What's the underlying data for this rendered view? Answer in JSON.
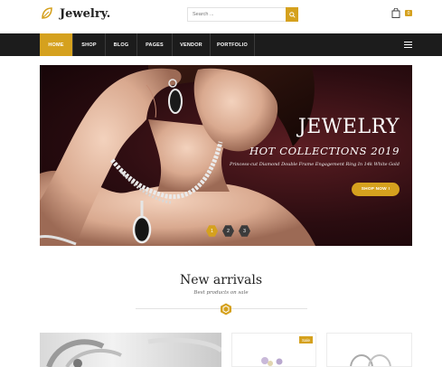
{
  "header": {
    "logo_text": "Jewelry.",
    "search_placeholder": "Search ...",
    "cart_count": "0"
  },
  "nav": {
    "items": [
      {
        "label": "HOME",
        "active": true
      },
      {
        "label": "SHOP"
      },
      {
        "label": "BLOG"
      },
      {
        "label": "PAGES"
      },
      {
        "label": "VENDOR"
      },
      {
        "label": "PORTFOLIO"
      }
    ]
  },
  "hero": {
    "title": "JEWELRY",
    "subtitle": "HOT COLLECTIONS 2019",
    "description": "Princess-cut Diamond Double Frame Engagement Ring In 14k White Gold",
    "button_label": "SHOP NOW !",
    "slides": [
      "1",
      "2",
      "3"
    ],
    "active_slide": "1"
  },
  "arrivals": {
    "title": "New arrivals",
    "subtitle": "Best products on sale"
  },
  "products": {
    "sale_badge": "Sale"
  },
  "colors": {
    "accent": "#d5a11e",
    "nav_bg": "#1c1c1c"
  }
}
